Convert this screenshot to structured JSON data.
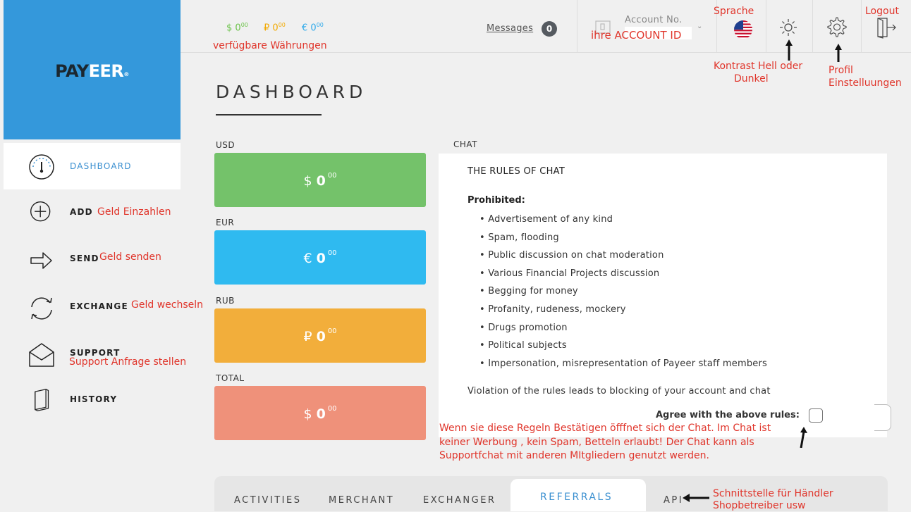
{
  "brand": {
    "logo_main": "PAY",
    "logo_accent": "EER",
    "logo_reg": "®"
  },
  "sidebar": {
    "items": [
      {
        "label": "DASHBOARD",
        "icon": "speedometer-icon",
        "active": true
      },
      {
        "label": "ADD",
        "icon": "plus-circle-icon",
        "note": "Geld Einzahlen"
      },
      {
        "label": "SEND",
        "icon": "arrow-right-icon",
        "note": "Geld senden"
      },
      {
        "label": "EXCHANGE",
        "icon": "refresh-icon",
        "note": "Geld wechseln"
      },
      {
        "label": "SUPPORT",
        "icon": "envelope-icon",
        "note": "Support Anfrage stellen"
      },
      {
        "label": "HISTORY",
        "icon": "book-icon"
      }
    ]
  },
  "header": {
    "balances": [
      {
        "symbol": "$",
        "value": "0",
        "cents": "00",
        "color": "#6cc24a"
      },
      {
        "symbol": "₽",
        "value": "0",
        "cents": "00",
        "color": "#f2a900"
      },
      {
        "symbol": "€",
        "value": "0",
        "cents": "00",
        "color": "#2ea9ea"
      }
    ],
    "balances_note": "verfügbare Währungen",
    "messages_label": "Messages",
    "messages_count": "0",
    "account_label": "Account No.",
    "account_note": "ihre ACCOUNT ID",
    "language_note": "Sprache",
    "contrast_note_1": "Kontrast Hell oder",
    "contrast_note_2": "Dunkel",
    "profile_note_1": "Profil",
    "profile_note_2": "Einstelluungen",
    "logout_note": "Logout"
  },
  "main": {
    "title": "DASHBOARD",
    "cards": [
      {
        "label": "USD",
        "symbol": "$",
        "value": "0",
        "cents": "00",
        "color": "#74c26a"
      },
      {
        "label": "EUR",
        "symbol": "€",
        "value": "0",
        "cents": "00",
        "color": "#2fbaf0"
      },
      {
        "label": "RUB",
        "symbol": "₽",
        "value": "0",
        "cents": "00",
        "color": "#f2ae3b"
      },
      {
        "label": "TOTAL",
        "symbol": "$",
        "value": "0",
        "cents": "00",
        "color": "#ef917a"
      }
    ]
  },
  "chat": {
    "label": "CHAT",
    "rules_title": "THE RULES OF CHAT",
    "prohibited_label": "Prohibited:",
    "rules": [
      "Advertisement of any kind",
      "Spam, flooding",
      "Public discussion on chat moderation",
      "Various Financial Projects discussion",
      "Begging for money",
      "Profanity, rudeness, mockery",
      "Drugs promotion",
      "Political subjects",
      "Impersonation, misrepresentation of Payeer staff members"
    ],
    "violation": "Violation of the rules leads to blocking of your account and chat",
    "agree_label": "Agree with the above rules:",
    "agree_note_1": "Wenn sie diese Regeln Bestätigen öfffnet sich der Chat. Im Chat ist",
    "agree_note_2": "keiner Werbung , kein Spam, Betteln erlaubt! Der Chat kann als",
    "agree_note_3": "Supportfchat mit anderen MItgliedern genutzt werden."
  },
  "tabs": {
    "items": [
      "ACTIVITIES",
      "MERCHANT",
      "EXCHANGER",
      "REFERRALS",
      "API"
    ],
    "active": "REFERRALS",
    "api_note_1": "Schnittstelle für Händler",
    "api_note_2": "Shopbetreiber usw"
  }
}
